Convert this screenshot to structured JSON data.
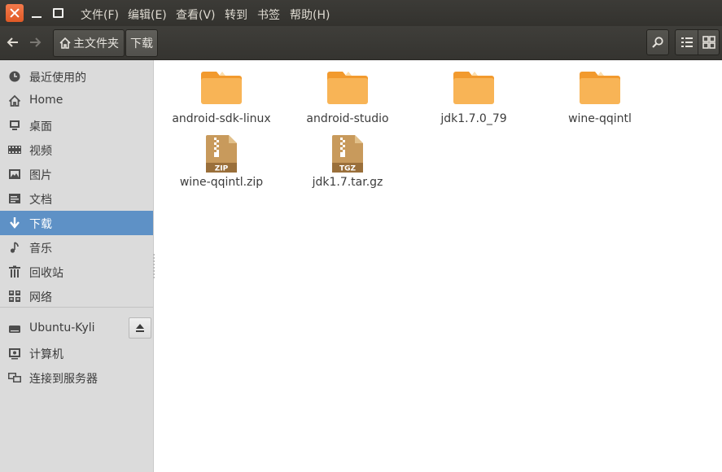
{
  "window": {
    "controls": {
      "close": "close-icon",
      "minimize": "minimize-icon",
      "maximize": "maximize-icon"
    }
  },
  "menu": [
    "文件(F)",
    "编辑(E)",
    "查看(V)",
    "转到",
    "书签",
    "帮助(H)"
  ],
  "toolbar": {
    "back_icon": "arrow-left-icon",
    "forward_icon": "arrow-right-icon",
    "breadcrumbs": [
      {
        "label": "主文件夹",
        "icon": "home-icon"
      },
      {
        "label": "下载"
      }
    ],
    "search_icon": "search-icon",
    "list_view_icon": "list-view-icon",
    "grid_view_icon": "grid-view-icon"
  },
  "sidebar": {
    "places": [
      {
        "label": "最近使用的",
        "icon": "clock-icon"
      },
      {
        "label": "Home",
        "icon": "home-icon"
      },
      {
        "label": "桌面",
        "icon": "desktop-icon"
      },
      {
        "label": "视频",
        "icon": "video-icon"
      },
      {
        "label": "图片",
        "icon": "picture-icon"
      },
      {
        "label": "文档",
        "icon": "document-icon"
      },
      {
        "label": "下载",
        "icon": "download-icon",
        "active": true
      },
      {
        "label": "音乐",
        "icon": "music-icon"
      },
      {
        "label": "回收站",
        "icon": "trash-icon"
      },
      {
        "label": "网络",
        "icon": "network-icon"
      }
    ],
    "devices": [
      {
        "label": "Ubuntu-Kyli",
        "icon": "drive-icon",
        "eject_icon": "eject-icon"
      },
      {
        "label": "计算机",
        "icon": "computer-icon"
      },
      {
        "label": "连接到服务器",
        "icon": "server-icon"
      }
    ]
  },
  "files": [
    {
      "name": "android-sdk-linux",
      "type": "folder"
    },
    {
      "name": "android-studio",
      "type": "folder"
    },
    {
      "name": "jdk1.7.0_79",
      "type": "folder"
    },
    {
      "name": "wine-qqintl",
      "type": "folder"
    },
    {
      "name": "wine-qqintl.zip",
      "type": "archive",
      "badge": "ZIP"
    },
    {
      "name": "jdk1.7.tar.gz",
      "type": "archive",
      "badge": "TGZ"
    }
  ],
  "colors": {
    "accent_orange": "#e95420",
    "selection_blue": "#5e91c6",
    "folder_orange": "#f6a43d",
    "archive_brown": "#b48a52"
  }
}
